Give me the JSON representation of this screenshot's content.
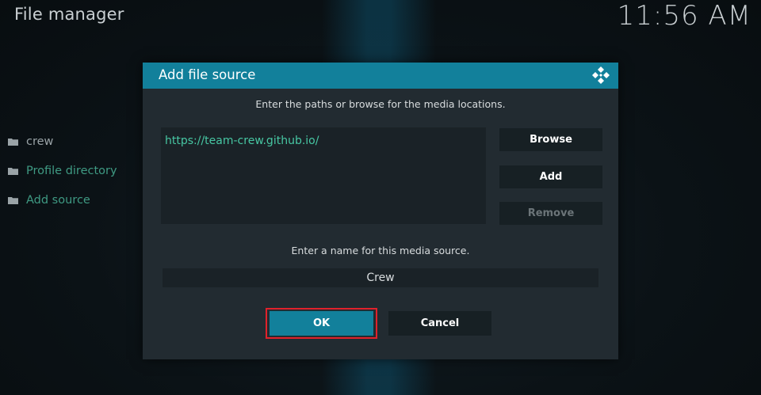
{
  "header": {
    "title": "File manager",
    "clock": "11:56 AM"
  },
  "sidebar": {
    "items": [
      {
        "label": "crew",
        "icon": "folder-icon"
      },
      {
        "label": "Profile directory",
        "icon": "folder-icon"
      },
      {
        "label": "Add source",
        "icon": "folder-icon"
      }
    ]
  },
  "dialog": {
    "title": "Add file source",
    "logo_icon": "kodi-logo-icon",
    "paths_instruction": "Enter the paths or browse for the media locations.",
    "paths": [
      "https://team-crew.github.io/"
    ],
    "browse_label": "Browse",
    "add_label": "Add",
    "remove_label": "Remove",
    "name_instruction": "Enter a name for this media source.",
    "name_value": "Crew",
    "ok_label": "OK",
    "cancel_label": "Cancel"
  },
  "colors": {
    "accent": "#12809b",
    "path_text": "#47c7a3",
    "highlight_border": "#e0222b"
  }
}
